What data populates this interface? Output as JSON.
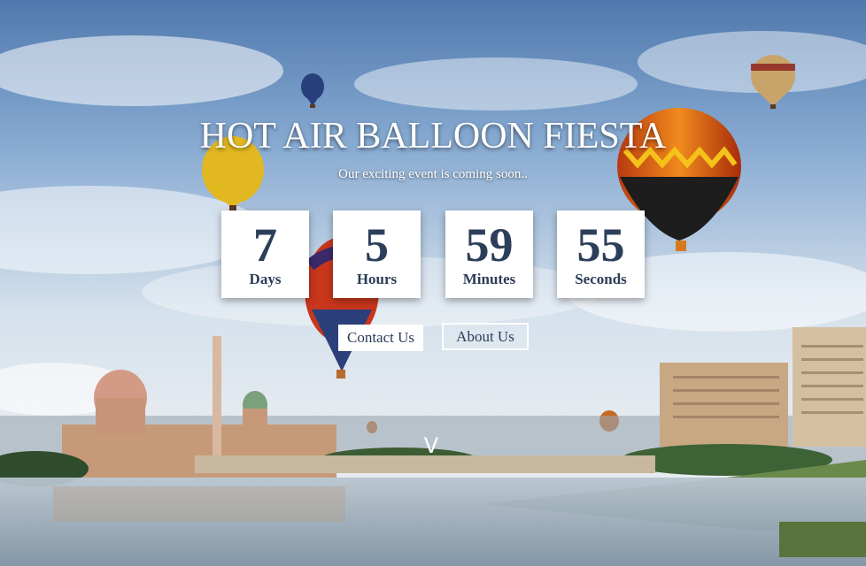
{
  "hero": {
    "title": "HOT AIR BALLOON FIESTA",
    "subtitle": "Our exciting event is coming soon.."
  },
  "countdown": [
    {
      "value": "7",
      "unit": "Days"
    },
    {
      "value": "5",
      "unit": "Hours"
    },
    {
      "value": "59",
      "unit": "Minutes"
    },
    {
      "value": "55",
      "unit": "Seconds"
    }
  ],
  "buttons": {
    "contact_label": "Contact Us",
    "about_label": "About Us"
  },
  "scroll": {
    "icon": "chevron-down-icon",
    "glyph": "V"
  },
  "colors": {
    "counter_text": "#2c3e59",
    "title_text": "#ffffff"
  }
}
